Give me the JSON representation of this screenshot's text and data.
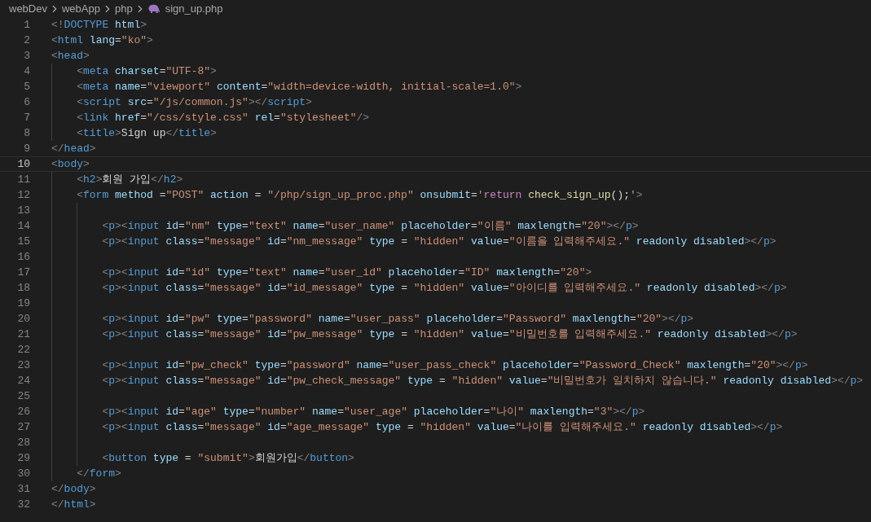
{
  "breadcrumb": [
    {
      "text": "webDev",
      "kind": "folder"
    },
    {
      "text": "webApp",
      "kind": "folder"
    },
    {
      "text": "php",
      "kind": "folder"
    },
    {
      "text": "sign_up.php",
      "kind": "file"
    }
  ],
  "lines": [
    {
      "number": "1",
      "current": false,
      "tokens": [
        {
          "kind": "punct",
          "text": "<!"
        },
        {
          "kind": "tag",
          "text": "DOCTYPE"
        },
        {
          "kind": "attr",
          "text": " html"
        },
        {
          "kind": "punct",
          "text": ">"
        }
      ]
    },
    {
      "number": "2",
      "current": false,
      "tokens": [
        {
          "kind": "punct",
          "text": "<"
        },
        {
          "kind": "tag",
          "text": "html"
        },
        {
          "kind": "attr",
          "text": " lang"
        },
        {
          "kind": "text",
          "text": "="
        },
        {
          "kind": "string",
          "text": "\"ko\""
        },
        {
          "kind": "punct",
          "text": ">"
        }
      ]
    },
    {
      "number": "3",
      "current": false,
      "tokens": [
        {
          "kind": "punct",
          "text": "<"
        },
        {
          "kind": "tag",
          "text": "head"
        },
        {
          "kind": "punct",
          "text": ">"
        }
      ]
    },
    {
      "number": "4",
      "current": false,
      "tokens": [
        {
          "kind": "punct",
          "text": "    <"
        },
        {
          "kind": "tag",
          "text": "meta"
        },
        {
          "kind": "attr",
          "text": " charset"
        },
        {
          "kind": "text",
          "text": "="
        },
        {
          "kind": "string",
          "text": "\"UTF-8\""
        },
        {
          "kind": "punct",
          "text": ">"
        }
      ]
    },
    {
      "number": "5",
      "current": false,
      "tokens": [
        {
          "kind": "punct",
          "text": "    <"
        },
        {
          "kind": "tag",
          "text": "meta"
        },
        {
          "kind": "attr",
          "text": " name"
        },
        {
          "kind": "text",
          "text": "="
        },
        {
          "kind": "string",
          "text": "\"viewport\""
        },
        {
          "kind": "attr",
          "text": " content"
        },
        {
          "kind": "text",
          "text": "="
        },
        {
          "kind": "string",
          "text": "\"width=device-width, initial-scale=1.0\""
        },
        {
          "kind": "punct",
          "text": ">"
        }
      ]
    },
    {
      "number": "6",
      "current": false,
      "tokens": [
        {
          "kind": "punct",
          "text": "    <"
        },
        {
          "kind": "tag",
          "text": "script"
        },
        {
          "kind": "attr",
          "text": " src"
        },
        {
          "kind": "text",
          "text": "="
        },
        {
          "kind": "string",
          "text": "\"/js/common.js\""
        },
        {
          "kind": "punct",
          "text": "></"
        },
        {
          "kind": "tag",
          "text": "script"
        },
        {
          "kind": "punct",
          "text": ">"
        }
      ]
    },
    {
      "number": "7",
      "current": false,
      "tokens": [
        {
          "kind": "punct",
          "text": "    <"
        },
        {
          "kind": "tag",
          "text": "link"
        },
        {
          "kind": "attr",
          "text": " href"
        },
        {
          "kind": "text",
          "text": "="
        },
        {
          "kind": "string",
          "text": "\"/css/style.css\""
        },
        {
          "kind": "attr",
          "text": " rel"
        },
        {
          "kind": "text",
          "text": "="
        },
        {
          "kind": "string",
          "text": "\"stylesheet\""
        },
        {
          "kind": "punct",
          "text": "/>"
        }
      ]
    },
    {
      "number": "8",
      "current": false,
      "tokens": [
        {
          "kind": "punct",
          "text": "    <"
        },
        {
          "kind": "tag",
          "text": "title"
        },
        {
          "kind": "punct",
          "text": ">"
        },
        {
          "kind": "text",
          "text": "Sign up"
        },
        {
          "kind": "punct",
          "text": "</"
        },
        {
          "kind": "tag",
          "text": "title"
        },
        {
          "kind": "punct",
          "text": ">"
        }
      ]
    },
    {
      "number": "9",
      "current": false,
      "tokens": [
        {
          "kind": "punct",
          "text": "</"
        },
        {
          "kind": "tag",
          "text": "head"
        },
        {
          "kind": "punct",
          "text": ">"
        }
      ]
    },
    {
      "number": "10",
      "current": true,
      "tokens": [
        {
          "kind": "punct",
          "text": "<"
        },
        {
          "kind": "tag",
          "text": "body"
        },
        {
          "kind": "punct",
          "text": ">"
        }
      ]
    },
    {
      "number": "11",
      "current": false,
      "tokens": [
        {
          "kind": "punct",
          "text": "    <"
        },
        {
          "kind": "tag",
          "text": "h2"
        },
        {
          "kind": "punct",
          "text": ">"
        },
        {
          "kind": "text",
          "text": "회원 가입"
        },
        {
          "kind": "punct",
          "text": "</"
        },
        {
          "kind": "tag",
          "text": "h2"
        },
        {
          "kind": "punct",
          "text": ">"
        }
      ]
    },
    {
      "number": "12",
      "current": false,
      "tokens": [
        {
          "kind": "punct",
          "text": "    <"
        },
        {
          "kind": "tag",
          "text": "form"
        },
        {
          "kind": "attr",
          "text": " method"
        },
        {
          "kind": "text",
          "text": " ="
        },
        {
          "kind": "string",
          "text": "\"POST\""
        },
        {
          "kind": "attr",
          "text": " action"
        },
        {
          "kind": "text",
          "text": " = "
        },
        {
          "kind": "string",
          "text": "\"/php/sign_up_proc.php\""
        },
        {
          "kind": "attr",
          "text": " onsubmit"
        },
        {
          "kind": "text",
          "text": "="
        },
        {
          "kind": "string",
          "text": "'"
        },
        {
          "kind": "keyword",
          "text": "return"
        },
        {
          "kind": "function",
          "text": " check_sign_up"
        },
        {
          "kind": "text",
          "text": "();"
        },
        {
          "kind": "string",
          "text": "'"
        },
        {
          "kind": "punct",
          "text": ">"
        }
      ]
    },
    {
      "number": "13",
      "current": false
    },
    {
      "number": "14",
      "current": false,
      "tokens": [
        {
          "kind": "punct",
          "text": "        <"
        },
        {
          "kind": "tag",
          "text": "p"
        },
        {
          "kind": "punct",
          "text": "><"
        },
        {
          "kind": "tag",
          "text": "input"
        },
        {
          "kind": "attr",
          "text": " id"
        },
        {
          "kind": "text",
          "text": "="
        },
        {
          "kind": "string",
          "text": "\"nm\""
        },
        {
          "kind": "attr",
          "text": " type"
        },
        {
          "kind": "text",
          "text": "="
        },
        {
          "kind": "string",
          "text": "\"text\""
        },
        {
          "kind": "attr",
          "text": " name"
        },
        {
          "kind": "text",
          "text": "="
        },
        {
          "kind": "string",
          "text": "\"user_name\""
        },
        {
          "kind": "attr",
          "text": " placeholder"
        },
        {
          "kind": "text",
          "text": "="
        },
        {
          "kind": "string",
          "text": "\"이름\""
        },
        {
          "kind": "attr",
          "text": " maxlength"
        },
        {
          "kind": "text",
          "text": "="
        },
        {
          "kind": "string",
          "text": "\"20\""
        },
        {
          "kind": "punct",
          "text": "></"
        },
        {
          "kind": "tag",
          "text": "p"
        },
        {
          "kind": "punct",
          "text": ">"
        }
      ]
    },
    {
      "number": "15",
      "current": false,
      "tokens": [
        {
          "kind": "punct",
          "text": "        <"
        },
        {
          "kind": "tag",
          "text": "p"
        },
        {
          "kind": "punct",
          "text": "><"
        },
        {
          "kind": "tag",
          "text": "input"
        },
        {
          "kind": "attr",
          "text": " class"
        },
        {
          "kind": "text",
          "text": "="
        },
        {
          "kind": "string",
          "text": "\"message\""
        },
        {
          "kind": "attr",
          "text": " id"
        },
        {
          "kind": "text",
          "text": "="
        },
        {
          "kind": "string",
          "text": "\"nm_message\""
        },
        {
          "kind": "attr",
          "text": " type"
        },
        {
          "kind": "text",
          "text": " = "
        },
        {
          "kind": "string",
          "text": "\"hidden\""
        },
        {
          "kind": "attr",
          "text": " value"
        },
        {
          "kind": "text",
          "text": "="
        },
        {
          "kind": "string",
          "text": "\"이름을 입력해주세요.\""
        },
        {
          "kind": "attr",
          "text": " readonly disabled"
        },
        {
          "kind": "punct",
          "text": "></"
        },
        {
          "kind": "tag",
          "text": "p"
        },
        {
          "kind": "punct",
          "text": ">"
        }
      ]
    },
    {
      "number": "16",
      "current": false
    },
    {
      "number": "17",
      "current": false,
      "tokens": [
        {
          "kind": "punct",
          "text": "        <"
        },
        {
          "kind": "tag",
          "text": "p"
        },
        {
          "kind": "punct",
          "text": "><"
        },
        {
          "kind": "tag",
          "text": "input"
        },
        {
          "kind": "attr",
          "text": " id"
        },
        {
          "kind": "text",
          "text": "="
        },
        {
          "kind": "string",
          "text": "\"id\""
        },
        {
          "kind": "attr",
          "text": " type"
        },
        {
          "kind": "text",
          "text": "="
        },
        {
          "kind": "string",
          "text": "\"text\""
        },
        {
          "kind": "attr",
          "text": " name"
        },
        {
          "kind": "text",
          "text": "="
        },
        {
          "kind": "string",
          "text": "\"user_id\""
        },
        {
          "kind": "attr",
          "text": " placeholder"
        },
        {
          "kind": "text",
          "text": "="
        },
        {
          "kind": "string",
          "text": "\"ID\""
        },
        {
          "kind": "attr",
          "text": " maxlength"
        },
        {
          "kind": "text",
          "text": "="
        },
        {
          "kind": "string",
          "text": "\"20\""
        },
        {
          "kind": "punct",
          "text": ">"
        }
      ]
    },
    {
      "number": "18",
      "current": false,
      "tokens": [
        {
          "kind": "punct",
          "text": "        <"
        },
        {
          "kind": "tag",
          "text": "p"
        },
        {
          "kind": "punct",
          "text": "><"
        },
        {
          "kind": "tag",
          "text": "input"
        },
        {
          "kind": "attr",
          "text": " class"
        },
        {
          "kind": "text",
          "text": "="
        },
        {
          "kind": "string",
          "text": "\"message\""
        },
        {
          "kind": "attr",
          "text": " id"
        },
        {
          "kind": "text",
          "text": "="
        },
        {
          "kind": "string",
          "text": "\"id_message\""
        },
        {
          "kind": "attr",
          "text": " type"
        },
        {
          "kind": "text",
          "text": " = "
        },
        {
          "kind": "string",
          "text": "\"hidden\""
        },
        {
          "kind": "attr",
          "text": " value"
        },
        {
          "kind": "text",
          "text": "="
        },
        {
          "kind": "string",
          "text": "\"아이디를 입력해주세요.\""
        },
        {
          "kind": "attr",
          "text": " readonly disabled"
        },
        {
          "kind": "punct",
          "text": "></"
        },
        {
          "kind": "tag",
          "text": "p"
        },
        {
          "kind": "punct",
          "text": ">"
        }
      ]
    },
    {
      "number": "19",
      "current": false
    },
    {
      "number": "20",
      "current": false,
      "tokens": [
        {
          "kind": "punct",
          "text": "        <"
        },
        {
          "kind": "tag",
          "text": "p"
        },
        {
          "kind": "punct",
          "text": "><"
        },
        {
          "kind": "tag",
          "text": "input"
        },
        {
          "kind": "attr",
          "text": " id"
        },
        {
          "kind": "text",
          "text": "="
        },
        {
          "kind": "string",
          "text": "\"pw\""
        },
        {
          "kind": "attr",
          "text": " type"
        },
        {
          "kind": "text",
          "text": "="
        },
        {
          "kind": "string",
          "text": "\"password\""
        },
        {
          "kind": "attr",
          "text": " name"
        },
        {
          "kind": "text",
          "text": "="
        },
        {
          "kind": "string",
          "text": "\"user_pass\""
        },
        {
          "kind": "attr",
          "text": " placeholder"
        },
        {
          "kind": "text",
          "text": "="
        },
        {
          "kind": "string",
          "text": "\"Password\""
        },
        {
          "kind": "attr",
          "text": " maxlength"
        },
        {
          "kind": "text",
          "text": "="
        },
        {
          "kind": "string",
          "text": "\"20\""
        },
        {
          "kind": "punct",
          "text": "></"
        },
        {
          "kind": "tag",
          "text": "p"
        },
        {
          "kind": "punct",
          "text": ">"
        }
      ]
    },
    {
      "number": "21",
      "current": false,
      "tokens": [
        {
          "kind": "punct",
          "text": "        <"
        },
        {
          "kind": "tag",
          "text": "p"
        },
        {
          "kind": "punct",
          "text": "><"
        },
        {
          "kind": "tag",
          "text": "input"
        },
        {
          "kind": "attr",
          "text": " class"
        },
        {
          "kind": "text",
          "text": "="
        },
        {
          "kind": "string",
          "text": "\"message\""
        },
        {
          "kind": "attr",
          "text": " id"
        },
        {
          "kind": "text",
          "text": "="
        },
        {
          "kind": "string",
          "text": "\"pw_message\""
        },
        {
          "kind": "attr",
          "text": " type"
        },
        {
          "kind": "text",
          "text": " = "
        },
        {
          "kind": "string",
          "text": "\"hidden\""
        },
        {
          "kind": "attr",
          "text": " value"
        },
        {
          "kind": "text",
          "text": "="
        },
        {
          "kind": "string",
          "text": "\"비밀번호를 입력해주세요.\""
        },
        {
          "kind": "attr",
          "text": " readonly disabled"
        },
        {
          "kind": "punct",
          "text": "></"
        },
        {
          "kind": "tag",
          "text": "p"
        },
        {
          "kind": "punct",
          "text": ">"
        }
      ]
    },
    {
      "number": "22",
      "current": false
    },
    {
      "number": "23",
      "current": false,
      "tokens": [
        {
          "kind": "punct",
          "text": "        <"
        },
        {
          "kind": "tag",
          "text": "p"
        },
        {
          "kind": "punct",
          "text": "><"
        },
        {
          "kind": "tag",
          "text": "input"
        },
        {
          "kind": "attr",
          "text": " id"
        },
        {
          "kind": "text",
          "text": "="
        },
        {
          "kind": "string",
          "text": "\"pw_check\""
        },
        {
          "kind": "attr",
          "text": " type"
        },
        {
          "kind": "text",
          "text": "="
        },
        {
          "kind": "string",
          "text": "\"password\""
        },
        {
          "kind": "attr",
          "text": " name"
        },
        {
          "kind": "text",
          "text": "="
        },
        {
          "kind": "string",
          "text": "\"user_pass_check\""
        },
        {
          "kind": "attr",
          "text": " placeholder"
        },
        {
          "kind": "text",
          "text": "="
        },
        {
          "kind": "string",
          "text": "\"Password_Check\""
        },
        {
          "kind": "attr",
          "text": " maxlength"
        },
        {
          "kind": "text",
          "text": "="
        },
        {
          "kind": "string",
          "text": "\"20\""
        },
        {
          "kind": "punct",
          "text": "></"
        },
        {
          "kind": "tag",
          "text": "p"
        },
        {
          "kind": "punct",
          "text": ">"
        }
      ]
    },
    {
      "number": "24",
      "current": false,
      "tokens": [
        {
          "kind": "punct",
          "text": "        <"
        },
        {
          "kind": "tag",
          "text": "p"
        },
        {
          "kind": "punct",
          "text": "><"
        },
        {
          "kind": "tag",
          "text": "input"
        },
        {
          "kind": "attr",
          "text": " class"
        },
        {
          "kind": "text",
          "text": "="
        },
        {
          "kind": "string",
          "text": "\"message\""
        },
        {
          "kind": "attr",
          "text": " id"
        },
        {
          "kind": "text",
          "text": "="
        },
        {
          "kind": "string",
          "text": "\"pw_check_message\""
        },
        {
          "kind": "attr",
          "text": " type"
        },
        {
          "kind": "text",
          "text": " = "
        },
        {
          "kind": "string",
          "text": "\"hidden\""
        },
        {
          "kind": "attr",
          "text": " value"
        },
        {
          "kind": "text",
          "text": "="
        },
        {
          "kind": "string",
          "text": "\"비밀번호가 일치하지 않습니다.\""
        },
        {
          "kind": "attr",
          "text": " readonly disabled"
        },
        {
          "kind": "punct",
          "text": "></"
        },
        {
          "kind": "tag",
          "text": "p"
        },
        {
          "kind": "punct",
          "text": ">"
        }
      ]
    },
    {
      "number": "25",
      "current": false
    },
    {
      "number": "26",
      "current": false,
      "tokens": [
        {
          "kind": "punct",
          "text": "        <"
        },
        {
          "kind": "tag",
          "text": "p"
        },
        {
          "kind": "punct",
          "text": "><"
        },
        {
          "kind": "tag",
          "text": "input"
        },
        {
          "kind": "attr",
          "text": " id"
        },
        {
          "kind": "text",
          "text": "="
        },
        {
          "kind": "string",
          "text": "\"age\""
        },
        {
          "kind": "attr",
          "text": " type"
        },
        {
          "kind": "text",
          "text": "="
        },
        {
          "kind": "string",
          "text": "\"number\""
        },
        {
          "kind": "attr",
          "text": " name"
        },
        {
          "kind": "text",
          "text": "="
        },
        {
          "kind": "string",
          "text": "\"user_age\""
        },
        {
          "kind": "attr",
          "text": " placeholder"
        },
        {
          "kind": "text",
          "text": "="
        },
        {
          "kind": "string",
          "text": "\"나이\""
        },
        {
          "kind": "attr",
          "text": " maxlength"
        },
        {
          "kind": "text",
          "text": "="
        },
        {
          "kind": "string",
          "text": "\"3\""
        },
        {
          "kind": "punct",
          "text": "></"
        },
        {
          "kind": "tag",
          "text": "p"
        },
        {
          "kind": "punct",
          "text": ">"
        }
      ]
    },
    {
      "number": "27",
      "current": false,
      "tokens": [
        {
          "kind": "punct",
          "text": "        <"
        },
        {
          "kind": "tag",
          "text": "p"
        },
        {
          "kind": "punct",
          "text": "><"
        },
        {
          "kind": "tag",
          "text": "input"
        },
        {
          "kind": "attr",
          "text": " class"
        },
        {
          "kind": "text",
          "text": "="
        },
        {
          "kind": "string",
          "text": "\"message\""
        },
        {
          "kind": "attr",
          "text": " id"
        },
        {
          "kind": "text",
          "text": "="
        },
        {
          "kind": "string",
          "text": "\"age_message\""
        },
        {
          "kind": "attr",
          "text": " type"
        },
        {
          "kind": "text",
          "text": " = "
        },
        {
          "kind": "string",
          "text": "\"hidden\""
        },
        {
          "kind": "attr",
          "text": " value"
        },
        {
          "kind": "text",
          "text": "="
        },
        {
          "kind": "string",
          "text": "\"나이를 입력해주세요.\""
        },
        {
          "kind": "attr",
          "text": " readonly disabled"
        },
        {
          "kind": "punct",
          "text": "></"
        },
        {
          "kind": "tag",
          "text": "p"
        },
        {
          "kind": "punct",
          "text": ">"
        }
      ]
    },
    {
      "number": "28",
      "current": false
    },
    {
      "number": "29",
      "current": false,
      "tokens": [
        {
          "kind": "punct",
          "text": "        <"
        },
        {
          "kind": "tag",
          "text": "button"
        },
        {
          "kind": "attr",
          "text": " type"
        },
        {
          "kind": "text",
          "text": " = "
        },
        {
          "kind": "string",
          "text": "\"submit\""
        },
        {
          "kind": "punct",
          "text": ">"
        },
        {
          "kind": "text",
          "text": "회원가입"
        },
        {
          "kind": "punct",
          "text": "</"
        },
        {
          "kind": "tag",
          "text": "button"
        },
        {
          "kind": "punct",
          "text": ">"
        }
      ]
    },
    {
      "number": "30",
      "current": false,
      "tokens": [
        {
          "kind": "punct",
          "text": "    </"
        },
        {
          "kind": "tag",
          "text": "form"
        },
        {
          "kind": "punct",
          "text": ">"
        }
      ]
    },
    {
      "number": "31",
      "current": false,
      "tokens": [
        {
          "kind": "punct",
          "text": "</"
        },
        {
          "kind": "tag",
          "text": "body"
        },
        {
          "kind": "punct",
          "text": ">"
        }
      ]
    },
    {
      "number": "32",
      "current": false,
      "tokens": [
        {
          "kind": "punct",
          "text": "</"
        },
        {
          "kind": "tag",
          "text": "html"
        },
        {
          "kind": "punct",
          "text": ">"
        }
      ]
    }
  ]
}
